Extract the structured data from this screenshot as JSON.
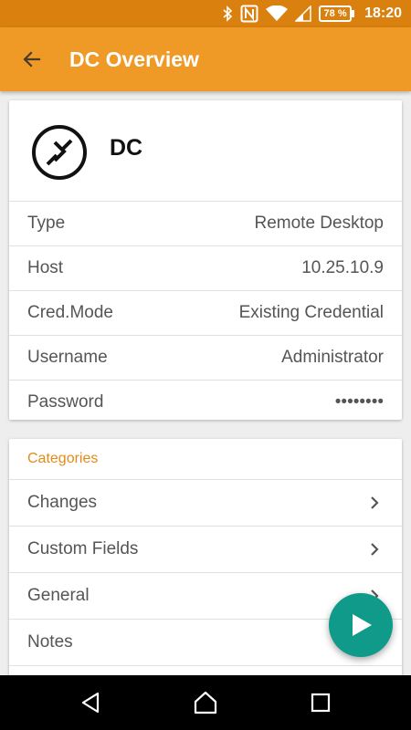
{
  "status_bar": {
    "battery": "78 %",
    "time": "18:20",
    "icons": [
      "bluetooth-icon",
      "nfc-icon",
      "wifi-icon",
      "signal-icon",
      "battery-icon"
    ]
  },
  "app_bar": {
    "title": "DC Overview",
    "back_icon": "arrow-left-icon"
  },
  "entry": {
    "name": "DC",
    "icon": "remote-desktop-icon",
    "properties": [
      {
        "label": "Type",
        "value": "Remote Desktop"
      },
      {
        "label": "Host",
        "value": "10.25.10.9"
      },
      {
        "label": "Cred.Mode",
        "value": "Existing Credential"
      },
      {
        "label": "Username",
        "value": "Administrator"
      },
      {
        "label": "Password",
        "value": "••••••••"
      }
    ]
  },
  "categories": {
    "title": "Categories",
    "items": [
      {
        "label": "Changes"
      },
      {
        "label": "Custom Fields"
      },
      {
        "label": "General"
      },
      {
        "label": "Notes"
      }
    ]
  },
  "fab": {
    "icon": "play-icon"
  },
  "nav_bar": {
    "icons": [
      "back-triangle-icon",
      "home-icon",
      "recents-icon"
    ]
  },
  "colors": {
    "status_bar": "#d9800f",
    "app_bar": "#ef9a26",
    "accent": "#e48a17",
    "fab": "#0f9a8a"
  }
}
